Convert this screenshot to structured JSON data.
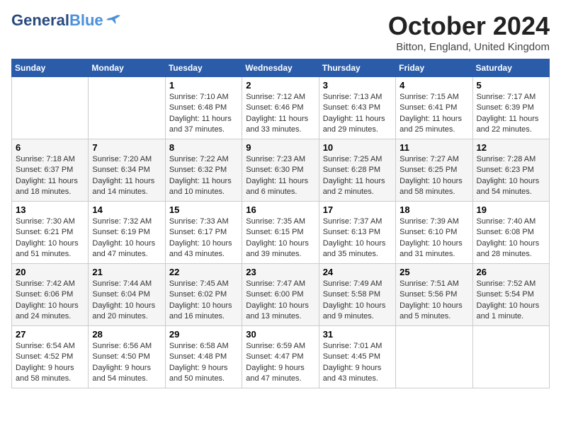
{
  "header": {
    "logo_general": "General",
    "logo_blue": "Blue",
    "month_title": "October 2024",
    "subtitle": "Bitton, England, United Kingdom"
  },
  "weekdays": [
    "Sunday",
    "Monday",
    "Tuesday",
    "Wednesday",
    "Thursday",
    "Friday",
    "Saturday"
  ],
  "weeks": [
    [
      {
        "day": "",
        "info": ""
      },
      {
        "day": "",
        "info": ""
      },
      {
        "day": "1",
        "info": "Sunrise: 7:10 AM\nSunset: 6:48 PM\nDaylight: 11 hours\nand 37 minutes."
      },
      {
        "day": "2",
        "info": "Sunrise: 7:12 AM\nSunset: 6:46 PM\nDaylight: 11 hours\nand 33 minutes."
      },
      {
        "day": "3",
        "info": "Sunrise: 7:13 AM\nSunset: 6:43 PM\nDaylight: 11 hours\nand 29 minutes."
      },
      {
        "day": "4",
        "info": "Sunrise: 7:15 AM\nSunset: 6:41 PM\nDaylight: 11 hours\nand 25 minutes."
      },
      {
        "day": "5",
        "info": "Sunrise: 7:17 AM\nSunset: 6:39 PM\nDaylight: 11 hours\nand 22 minutes."
      }
    ],
    [
      {
        "day": "6",
        "info": "Sunrise: 7:18 AM\nSunset: 6:37 PM\nDaylight: 11 hours\nand 18 minutes."
      },
      {
        "day": "7",
        "info": "Sunrise: 7:20 AM\nSunset: 6:34 PM\nDaylight: 11 hours\nand 14 minutes."
      },
      {
        "day": "8",
        "info": "Sunrise: 7:22 AM\nSunset: 6:32 PM\nDaylight: 11 hours\nand 10 minutes."
      },
      {
        "day": "9",
        "info": "Sunrise: 7:23 AM\nSunset: 6:30 PM\nDaylight: 11 hours\nand 6 minutes."
      },
      {
        "day": "10",
        "info": "Sunrise: 7:25 AM\nSunset: 6:28 PM\nDaylight: 11 hours\nand 2 minutes."
      },
      {
        "day": "11",
        "info": "Sunrise: 7:27 AM\nSunset: 6:25 PM\nDaylight: 10 hours\nand 58 minutes."
      },
      {
        "day": "12",
        "info": "Sunrise: 7:28 AM\nSunset: 6:23 PM\nDaylight: 10 hours\nand 54 minutes."
      }
    ],
    [
      {
        "day": "13",
        "info": "Sunrise: 7:30 AM\nSunset: 6:21 PM\nDaylight: 10 hours\nand 51 minutes."
      },
      {
        "day": "14",
        "info": "Sunrise: 7:32 AM\nSunset: 6:19 PM\nDaylight: 10 hours\nand 47 minutes."
      },
      {
        "day": "15",
        "info": "Sunrise: 7:33 AM\nSunset: 6:17 PM\nDaylight: 10 hours\nand 43 minutes."
      },
      {
        "day": "16",
        "info": "Sunrise: 7:35 AM\nSunset: 6:15 PM\nDaylight: 10 hours\nand 39 minutes."
      },
      {
        "day": "17",
        "info": "Sunrise: 7:37 AM\nSunset: 6:13 PM\nDaylight: 10 hours\nand 35 minutes."
      },
      {
        "day": "18",
        "info": "Sunrise: 7:39 AM\nSunset: 6:10 PM\nDaylight: 10 hours\nand 31 minutes."
      },
      {
        "day": "19",
        "info": "Sunrise: 7:40 AM\nSunset: 6:08 PM\nDaylight: 10 hours\nand 28 minutes."
      }
    ],
    [
      {
        "day": "20",
        "info": "Sunrise: 7:42 AM\nSunset: 6:06 PM\nDaylight: 10 hours\nand 24 minutes."
      },
      {
        "day": "21",
        "info": "Sunrise: 7:44 AM\nSunset: 6:04 PM\nDaylight: 10 hours\nand 20 minutes."
      },
      {
        "day": "22",
        "info": "Sunrise: 7:45 AM\nSunset: 6:02 PM\nDaylight: 10 hours\nand 16 minutes."
      },
      {
        "day": "23",
        "info": "Sunrise: 7:47 AM\nSunset: 6:00 PM\nDaylight: 10 hours\nand 13 minutes."
      },
      {
        "day": "24",
        "info": "Sunrise: 7:49 AM\nSunset: 5:58 PM\nDaylight: 10 hours\nand 9 minutes."
      },
      {
        "day": "25",
        "info": "Sunrise: 7:51 AM\nSunset: 5:56 PM\nDaylight: 10 hours\nand 5 minutes."
      },
      {
        "day": "26",
        "info": "Sunrise: 7:52 AM\nSunset: 5:54 PM\nDaylight: 10 hours\nand 1 minute."
      }
    ],
    [
      {
        "day": "27",
        "info": "Sunrise: 6:54 AM\nSunset: 4:52 PM\nDaylight: 9 hours\nand 58 minutes."
      },
      {
        "day": "28",
        "info": "Sunrise: 6:56 AM\nSunset: 4:50 PM\nDaylight: 9 hours\nand 54 minutes."
      },
      {
        "day": "29",
        "info": "Sunrise: 6:58 AM\nSunset: 4:48 PM\nDaylight: 9 hours\nand 50 minutes."
      },
      {
        "day": "30",
        "info": "Sunrise: 6:59 AM\nSunset: 4:47 PM\nDaylight: 9 hours\nand 47 minutes."
      },
      {
        "day": "31",
        "info": "Sunrise: 7:01 AM\nSunset: 4:45 PM\nDaylight: 9 hours\nand 43 minutes."
      },
      {
        "day": "",
        "info": ""
      },
      {
        "day": "",
        "info": ""
      }
    ]
  ]
}
